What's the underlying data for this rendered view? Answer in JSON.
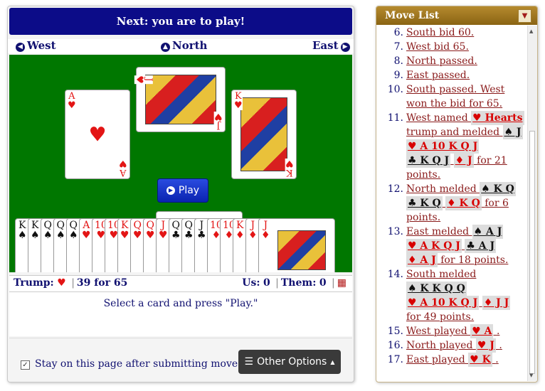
{
  "banner": {
    "text": "Next: you are to play!"
  },
  "seats": {
    "west": {
      "label": "West",
      "icon": "arrow-left-circle-icon"
    },
    "north": {
      "label": "North",
      "icon": "arrow-up-circle-icon"
    },
    "east": {
      "label": "East",
      "icon": "arrow-right-circle-icon"
    }
  },
  "trick": {
    "west_card": {
      "rank": "A",
      "suit": "♥",
      "color": "#e31515"
    },
    "north_card": {
      "rank": "J",
      "suit": "♥",
      "color": "#e31515"
    },
    "east_card": {
      "rank": "K",
      "suit": "♥",
      "color": "#e31515"
    }
  },
  "play_button": {
    "label": "Play",
    "icon": "play-circle-icon"
  },
  "hand": [
    {
      "rank": "K",
      "suit": "♠",
      "color": "#111111"
    },
    {
      "rank": "K",
      "suit": "♠",
      "color": "#111111"
    },
    {
      "rank": "Q",
      "suit": "♠",
      "color": "#111111"
    },
    {
      "rank": "Q",
      "suit": "♠",
      "color": "#111111"
    },
    {
      "rank": "Q",
      "suit": "♠",
      "color": "#111111"
    },
    {
      "rank": "A",
      "suit": "♥",
      "color": "#e31515"
    },
    {
      "rank": "10",
      "suit": "♥",
      "color": "#e31515"
    },
    {
      "rank": "10",
      "suit": "♥",
      "color": "#e31515"
    },
    {
      "rank": "K",
      "suit": "♥",
      "color": "#e31515"
    },
    {
      "rank": "Q",
      "suit": "♥",
      "color": "#e31515"
    },
    {
      "rank": "Q",
      "suit": "♥",
      "color": "#e31515"
    },
    {
      "rank": "J",
      "suit": "♥",
      "color": "#e31515"
    },
    {
      "rank": "Q",
      "suit": "♣",
      "color": "#111111"
    },
    {
      "rank": "Q",
      "suit": "♣",
      "color": "#111111"
    },
    {
      "rank": "J",
      "suit": "♣",
      "color": "#111111"
    },
    {
      "rank": "10",
      "suit": "♦",
      "color": "#e31515"
    },
    {
      "rank": "10",
      "suit": "♦",
      "color": "#e31515"
    },
    {
      "rank": "K",
      "suit": "♦",
      "color": "#e31515"
    },
    {
      "rank": "J",
      "suit": "♦",
      "color": "#e31515"
    },
    {
      "rank": "J",
      "suit": "♦",
      "color": "#e31515"
    }
  ],
  "status": {
    "trump_label": "Trump:",
    "trump_suit": "♥",
    "bid": "39 for 65",
    "us_label": "Us:",
    "us_value": "0",
    "them_label": "Them:",
    "them_value": "0",
    "table_icon": "table-icon"
  },
  "instruction": "Select a card and press \"Play.\"",
  "footer": {
    "stay_checked": true,
    "stay_label": "Stay on this page after submitting move.",
    "other_options": "Other Options"
  },
  "move_list": {
    "title": "Move List",
    "toggle_icon": "collapse-icon",
    "moves": [
      {
        "n": "6.",
        "text": "South bid 60."
      },
      {
        "n": "7.",
        "text": "West bid 65."
      },
      {
        "n": "8.",
        "text": "North passed."
      },
      {
        "n": "9.",
        "text": "East passed."
      },
      {
        "n": "10.",
        "text": "South passed. West won the bid for 65."
      },
      {
        "n": "11.",
        "pre": "West named",
        "chips": [
          {
            "t": "♥ Hearts",
            "c": "r"
          }
        ],
        "mid": "trump and melded",
        "chips2": [
          {
            "t": "♠ J",
            "c": "k"
          },
          {
            "t": "♥ A 10 K Q J",
            "c": "r"
          },
          {
            "t": "♣ K Q J",
            "c": "k"
          },
          {
            "t": "♦ J",
            "c": "r"
          }
        ],
        "post": "for 21 points."
      },
      {
        "n": "12.",
        "pre": "North melded",
        "chips": [
          {
            "t": "♠ K Q",
            "c": "k"
          },
          {
            "t": "♣ K Q",
            "c": "k"
          },
          {
            "t": "♦ K Q",
            "c": "r"
          }
        ],
        "post": "for 6 points."
      },
      {
        "n": "13.",
        "pre": "East melded",
        "chips": [
          {
            "t": "♠ A J",
            "c": "k"
          },
          {
            "t": "♥ A K Q J",
            "c": "r"
          },
          {
            "t": "♣ A J",
            "c": "k"
          },
          {
            "t": "♦ A J",
            "c": "r"
          }
        ],
        "post": "for 18 points."
      },
      {
        "n": "14.",
        "pre": "South melded",
        "chips": [
          {
            "t": "♠ K K Q Q",
            "c": "k"
          },
          {
            "t": "♥ A 10 K Q J",
            "c": "r"
          },
          {
            "t": "♦ J J",
            "c": "r"
          }
        ],
        "post": "for 49 points."
      },
      {
        "n": "15.",
        "pre": "West played",
        "chips": [
          {
            "t": "♥ A",
            "c": "r"
          }
        ],
        "post": "."
      },
      {
        "n": "16.",
        "pre": "North played",
        "chips": [
          {
            "t": "♥ J",
            "c": "r"
          }
        ],
        "post": "."
      },
      {
        "n": "17.",
        "pre": "East played",
        "chips": [
          {
            "t": "♥ K",
            "c": "r"
          }
        ],
        "post": "."
      }
    ]
  }
}
